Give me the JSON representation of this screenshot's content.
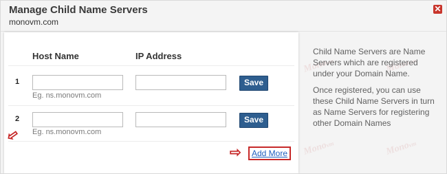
{
  "dialog": {
    "title": "Manage Child Name Servers",
    "domain": "monovm.com",
    "close_icon": "close-icon"
  },
  "form": {
    "headers": {
      "host": "Host Name",
      "ip": "IP Address"
    },
    "rows": [
      {
        "num": "1",
        "host_value": "",
        "ip_value": "",
        "hint": "Eg. ns.monovm.com",
        "save_label": "Save"
      },
      {
        "num": "2",
        "host_value": "",
        "ip_value": "",
        "hint": "Eg. ns.monovm.com",
        "save_label": "Save"
      }
    ],
    "add_more_label": "Add More"
  },
  "info": {
    "para1": "Child Name Servers are Name Servers which are registered under your Domain Name.",
    "para2": "Once registered, you can use these Child Name Servers in turn as Name Servers for registering other Domain Names"
  },
  "watermark": "Mono",
  "colors": {
    "accent": "#2e5e8f",
    "annotation": "#c62828",
    "link": "#1f5fbf"
  }
}
